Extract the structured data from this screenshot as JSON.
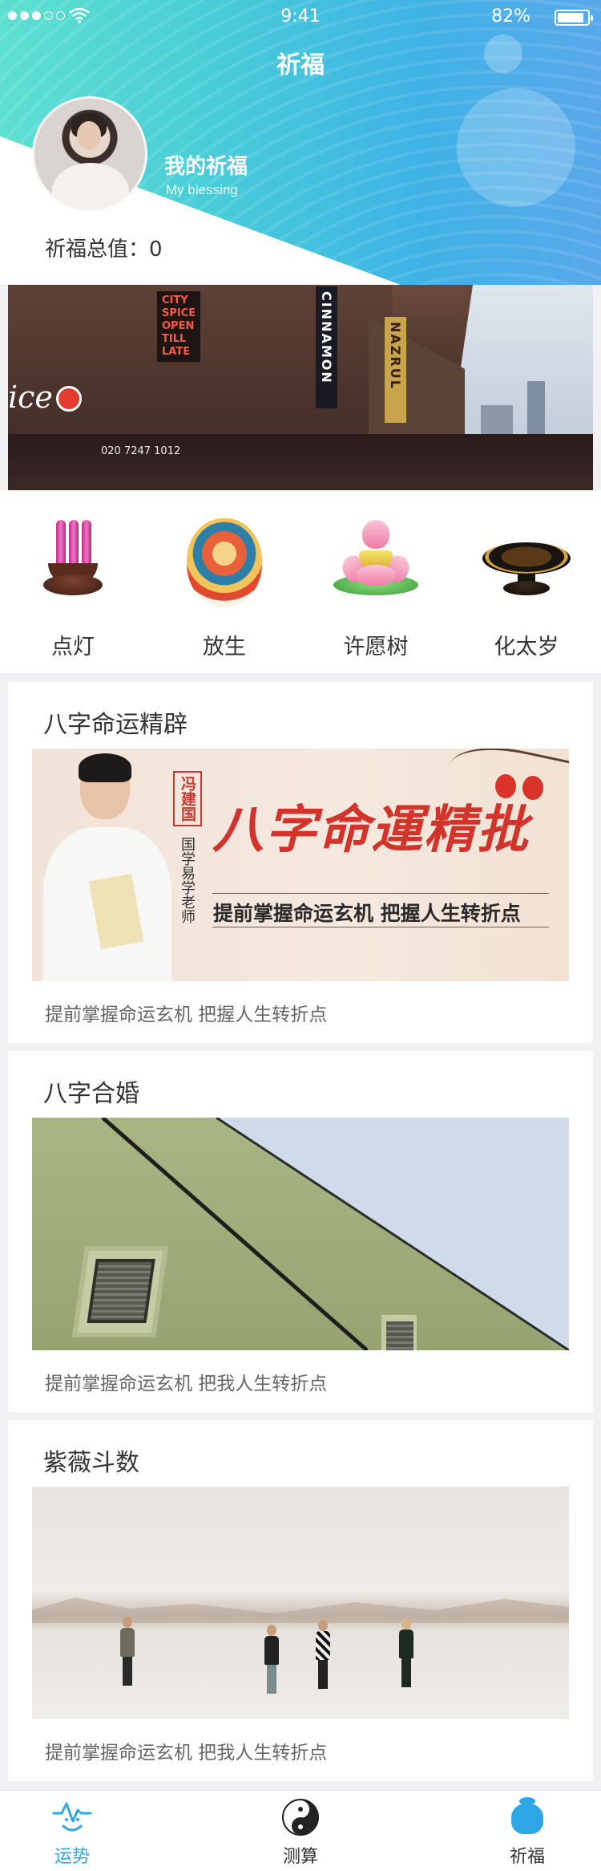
{
  "status": {
    "time": "9:41",
    "battery": "82%"
  },
  "header": {
    "title": "祈福",
    "profile_title": "我的祈福",
    "profile_subtitle": "My blessing",
    "total_label": "祈福总值：",
    "total_value": "0"
  },
  "banner": {
    "signs": [
      "CITY",
      "SPICE",
      "OPEN",
      "TILL",
      "LATE"
    ],
    "word": "ice",
    "phone": "020 7247 1012",
    "vertical_sign": "CINNAMON",
    "vertical_sign2": "NAZRUL"
  },
  "quick_menu": [
    {
      "label": "点灯",
      "icon": "incense-burner-icon"
    },
    {
      "label": "放生",
      "icon": "thangka-deity-icon"
    },
    {
      "label": "许愿树",
      "icon": "lotus-lamp-icon"
    },
    {
      "label": "化太岁",
      "icon": "offering-tray-icon"
    }
  ],
  "cards": [
    {
      "title": "八字命运精辟",
      "desc": "提前掌握命运玄机 把握人生转折点",
      "image": {
        "name": "冯建国",
        "role": "国学易学老师",
        "headline": "八字命運精批",
        "slogan": "提前掌握命运玄机 把握人生转折点"
      }
    },
    {
      "title": "八字合婚",
      "desc": "提前掌握命运玄机 把我人生转折点"
    },
    {
      "title": "紫薇斗数",
      "desc": "提前掌握命运玄机 把我人生转折点"
    }
  ],
  "tabbar": [
    {
      "label": "运势",
      "icon": "fortune-wave-icon",
      "active": true
    },
    {
      "label": "测算",
      "icon": "yin-yang-icon",
      "active": false
    },
    {
      "label": "祈福",
      "icon": "blessing-pot-icon",
      "active": false
    }
  ],
  "colors": {
    "accent": "#2ea7e6",
    "header_start": "#5ee0d0",
    "header_end": "#59a8ea"
  }
}
